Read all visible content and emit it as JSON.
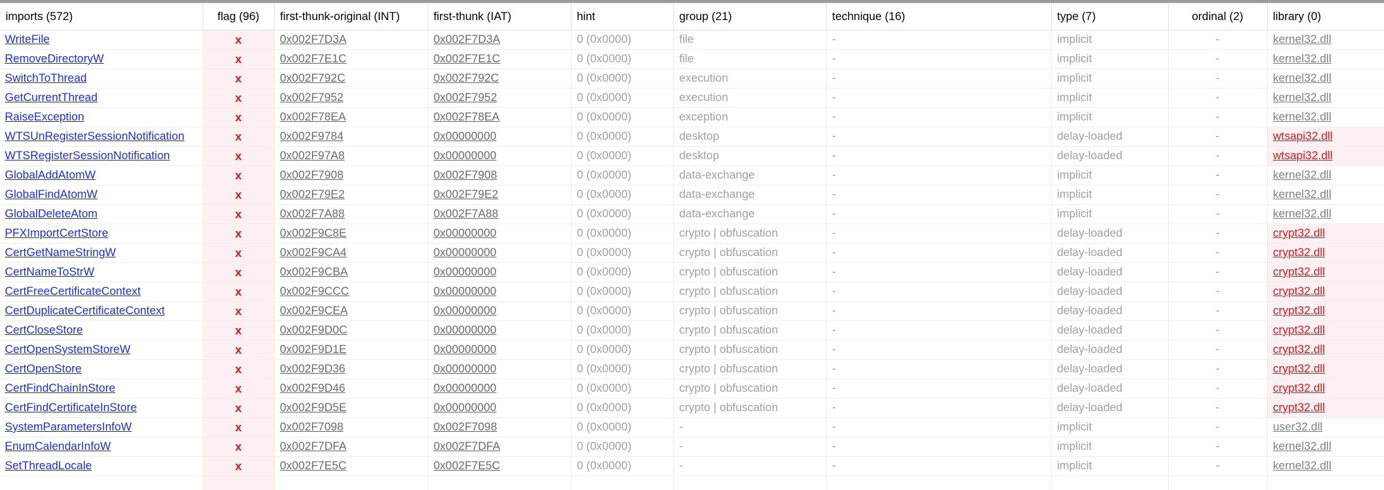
{
  "columns": {
    "imports": "imports (572)",
    "flag": "flag (96)",
    "int": "first-thunk-original (INT)",
    "iat": "first-thunk (IAT)",
    "hint": "hint",
    "group": "group (21)",
    "technique": "technique (16)",
    "type": "type (7)",
    "ordinal": "ordinal (2)",
    "library": "library (0)"
  },
  "colors": {
    "link": "#1a2fd0",
    "flag": "#d01818",
    "flag_bg": "#fdf0f3",
    "muted": "#a0a0a0"
  },
  "rows": [
    {
      "name": "WriteFile",
      "flag": "x",
      "int": "0x002F7D3A",
      "iat": "0x002F7D3A",
      "hint": "0 (0x0000)",
      "group": "file",
      "technique": "-",
      "type": "implicit",
      "ordinal": "-",
      "library": "kernel32.dll",
      "lib_flag": false
    },
    {
      "name": "RemoveDirectoryW",
      "flag": "x",
      "int": "0x002F7E1C",
      "iat": "0x002F7E1C",
      "hint": "0 (0x0000)",
      "group": "file",
      "technique": "-",
      "type": "implicit",
      "ordinal": "-",
      "library": "kernel32.dll",
      "lib_flag": false
    },
    {
      "name": "SwitchToThread",
      "flag": "x",
      "int": "0x002F792C",
      "iat": "0x002F792C",
      "hint": "0 (0x0000)",
      "group": "execution",
      "technique": "-",
      "type": "implicit",
      "ordinal": "-",
      "library": "kernel32.dll",
      "lib_flag": false
    },
    {
      "name": "GetCurrentThread",
      "flag": "x",
      "int": "0x002F7952",
      "iat": "0x002F7952",
      "hint": "0 (0x0000)",
      "group": "execution",
      "technique": "-",
      "type": "implicit",
      "ordinal": "-",
      "library": "kernel32.dll",
      "lib_flag": false
    },
    {
      "name": "RaiseException",
      "flag": "x",
      "int": "0x002F78EA",
      "iat": "0x002F78EA",
      "hint": "0 (0x0000)",
      "group": "exception",
      "technique": "-",
      "type": "implicit",
      "ordinal": "-",
      "library": "kernel32.dll",
      "lib_flag": false
    },
    {
      "name": "WTSUnRegisterSessionNotification",
      "flag": "x",
      "int": "0x002F9784",
      "iat": "0x00000000",
      "hint": "0 (0x0000)",
      "group": "desktop",
      "technique": "-",
      "type": "delay-loaded",
      "ordinal": "-",
      "library": "wtsapi32.dll",
      "lib_flag": true
    },
    {
      "name": "WTSRegisterSessionNotification",
      "flag": "x",
      "int": "0x002F97A8",
      "iat": "0x00000000",
      "hint": "0 (0x0000)",
      "group": "desktop",
      "technique": "-",
      "type": "delay-loaded",
      "ordinal": "-",
      "library": "wtsapi32.dll",
      "lib_flag": true
    },
    {
      "name": "GlobalAddAtomW",
      "flag": "x",
      "int": "0x002F7908",
      "iat": "0x002F7908",
      "hint": "0 (0x0000)",
      "group": "data-exchange",
      "technique": "-",
      "type": "implicit",
      "ordinal": "-",
      "library": "kernel32.dll",
      "lib_flag": false
    },
    {
      "name": "GlobalFindAtomW",
      "flag": "x",
      "int": "0x002F79E2",
      "iat": "0x002F79E2",
      "hint": "0 (0x0000)",
      "group": "data-exchange",
      "technique": "-",
      "type": "implicit",
      "ordinal": "-",
      "library": "kernel32.dll",
      "lib_flag": false
    },
    {
      "name": "GlobalDeleteAtom",
      "flag": "x",
      "int": "0x002F7A88",
      "iat": "0x002F7A88",
      "hint": "0 (0x0000)",
      "group": "data-exchange",
      "technique": "-",
      "type": "implicit",
      "ordinal": "-",
      "library": "kernel32.dll",
      "lib_flag": false
    },
    {
      "name": "PFXImportCertStore",
      "flag": "x",
      "int": "0x002F9C8E",
      "iat": "0x00000000",
      "hint": "0 (0x0000)",
      "group": "crypto | obfuscation",
      "technique": "-",
      "type": "delay-loaded",
      "ordinal": "-",
      "library": "crypt32.dll",
      "lib_flag": true
    },
    {
      "name": "CertGetNameStringW",
      "flag": "x",
      "int": "0x002F9CA4",
      "iat": "0x00000000",
      "hint": "0 (0x0000)",
      "group": "crypto | obfuscation",
      "technique": "-",
      "type": "delay-loaded",
      "ordinal": "-",
      "library": "crypt32.dll",
      "lib_flag": true
    },
    {
      "name": "CertNameToStrW",
      "flag": "x",
      "int": "0x002F9CBA",
      "iat": "0x00000000",
      "hint": "0 (0x0000)",
      "group": "crypto | obfuscation",
      "technique": "-",
      "type": "delay-loaded",
      "ordinal": "-",
      "library": "crypt32.dll",
      "lib_flag": true
    },
    {
      "name": "CertFreeCertificateContext",
      "flag": "x",
      "int": "0x002F9CCC",
      "iat": "0x00000000",
      "hint": "0 (0x0000)",
      "group": "crypto | obfuscation",
      "technique": "-",
      "type": "delay-loaded",
      "ordinal": "-",
      "library": "crypt32.dll",
      "lib_flag": true
    },
    {
      "name": "CertDuplicateCertificateContext",
      "flag": "x",
      "int": "0x002F9CEA",
      "iat": "0x00000000",
      "hint": "0 (0x0000)",
      "group": "crypto | obfuscation",
      "technique": "-",
      "type": "delay-loaded",
      "ordinal": "-",
      "library": "crypt32.dll",
      "lib_flag": true
    },
    {
      "name": "CertCloseStore",
      "flag": "x",
      "int": "0x002F9D0C",
      "iat": "0x00000000",
      "hint": "0 (0x0000)",
      "group": "crypto | obfuscation",
      "technique": "-",
      "type": "delay-loaded",
      "ordinal": "-",
      "library": "crypt32.dll",
      "lib_flag": true
    },
    {
      "name": "CertOpenSystemStoreW",
      "flag": "x",
      "int": "0x002F9D1E",
      "iat": "0x00000000",
      "hint": "0 (0x0000)",
      "group": "crypto | obfuscation",
      "technique": "-",
      "type": "delay-loaded",
      "ordinal": "-",
      "library": "crypt32.dll",
      "lib_flag": true
    },
    {
      "name": "CertOpenStore",
      "flag": "x",
      "int": "0x002F9D36",
      "iat": "0x00000000",
      "hint": "0 (0x0000)",
      "group": "crypto | obfuscation",
      "technique": "-",
      "type": "delay-loaded",
      "ordinal": "-",
      "library": "crypt32.dll",
      "lib_flag": true
    },
    {
      "name": "CertFindChainInStore",
      "flag": "x",
      "int": "0x002F9D46",
      "iat": "0x00000000",
      "hint": "0 (0x0000)",
      "group": "crypto | obfuscation",
      "technique": "-",
      "type": "delay-loaded",
      "ordinal": "-",
      "library": "crypt32.dll",
      "lib_flag": true
    },
    {
      "name": "CertFindCertificateInStore",
      "flag": "x",
      "int": "0x002F9D5E",
      "iat": "0x00000000",
      "hint": "0 (0x0000)",
      "group": "crypto | obfuscation",
      "technique": "-",
      "type": "delay-loaded",
      "ordinal": "-",
      "library": "crypt32.dll",
      "lib_flag": true
    },
    {
      "name": "SystemParametersInfoW",
      "flag": "x",
      "int": "0x002F7098",
      "iat": "0x002F7098",
      "hint": "0 (0x0000)",
      "group": "-",
      "technique": "-",
      "type": "implicit",
      "ordinal": "-",
      "library": "user32.dll",
      "lib_flag": false
    },
    {
      "name": "EnumCalendarInfoW",
      "flag": "x",
      "int": "0x002F7DFA",
      "iat": "0x002F7DFA",
      "hint": "0 (0x0000)",
      "group": "-",
      "technique": "-",
      "type": "implicit",
      "ordinal": "-",
      "library": "kernel32.dll",
      "lib_flag": false
    },
    {
      "name": "SetThreadLocale",
      "flag": "x",
      "int": "0x002F7E5C",
      "iat": "0x002F7E5C",
      "hint": "0 (0x0000)",
      "group": "-",
      "technique": "-",
      "type": "implicit",
      "ordinal": "-",
      "library": "kernel32.dll",
      "lib_flag": false
    }
  ]
}
